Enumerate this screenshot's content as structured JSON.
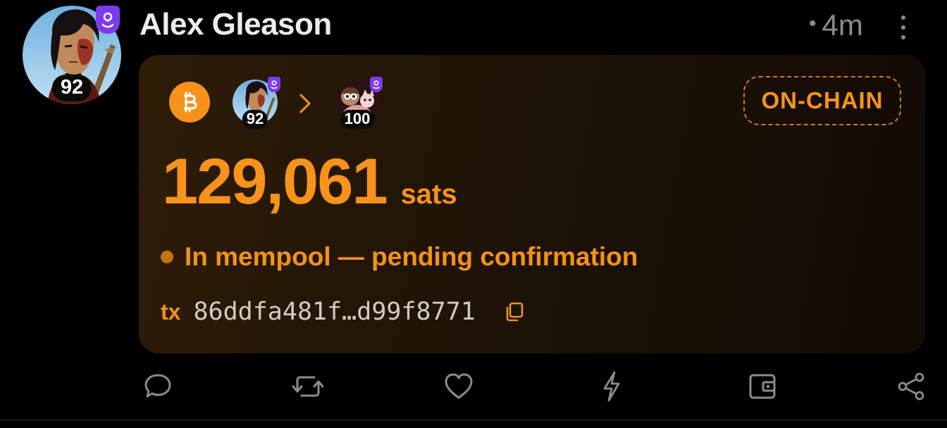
{
  "post": {
    "author": {
      "name": "Alex Gleason",
      "score": "92",
      "avatar_icon": "user-avatar",
      "verified_icon": "shield-badge-icon"
    },
    "time": {
      "separator": "•",
      "ago": "4m"
    },
    "more_icon": "more-vertical-icon"
  },
  "zap": {
    "method_icon": "bitcoin-icon",
    "from": {
      "score": "92"
    },
    "to": {
      "score": "100"
    },
    "badge": "ON-CHAIN",
    "amount": "129,061",
    "unit": "sats",
    "status": "In mempool — pending confirmation",
    "tx_label": "tx",
    "tx_hash": "86ddfa481f…d99f8771",
    "copy_icon": "copy-icon"
  },
  "actions": [
    {
      "name": "reply",
      "icon": "comment-icon"
    },
    {
      "name": "repost",
      "icon": "repost-icon"
    },
    {
      "name": "like",
      "icon": "heart-icon"
    },
    {
      "name": "zap",
      "icon": "lightning-icon"
    },
    {
      "name": "wallet",
      "icon": "wallet-icon"
    },
    {
      "name": "share",
      "icon": "share-icon"
    }
  ],
  "colors": {
    "background": "#000000",
    "accent": "#f7931a",
    "verified": "#7c3aed",
    "icon": "#8c8c8c"
  }
}
